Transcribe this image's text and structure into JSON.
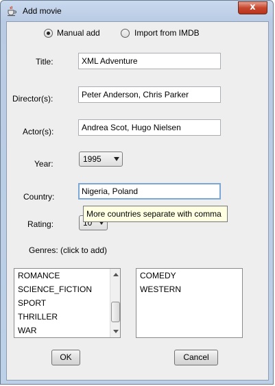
{
  "window": {
    "title": "Add movie",
    "close_symbol": "x",
    "close_icon": "close-icon",
    "app_icon": "java-cup-icon"
  },
  "mode": {
    "manual_label": "Manual add",
    "imdb_label": "Import from IMDB",
    "selected": "manual"
  },
  "form": {
    "title_label": "Title:",
    "title_value": "XML Adventure",
    "director_label": "Director(s):",
    "director_value": "Peter Anderson, Chris Parker",
    "actors_label": "Actor(s):",
    "actors_value": "Andrea Scot, Hugo Nielsen",
    "year_label": "Year:",
    "year_value": "1995",
    "country_label": "Country:",
    "country_value": "Nigeria, Poland",
    "country_tooltip": "More countries separate with comma",
    "rating_label": "Rating:",
    "rating_value": "10",
    "genres_label": "Genres: (click to add)"
  },
  "genres": {
    "available": [
      "ROMANCE",
      "SCIENCE_FICTION",
      "SPORT",
      "THRILLER",
      "WAR"
    ],
    "selected": [
      "COMEDY",
      "WESTERN"
    ],
    "available_scroll_position": 0.85
  },
  "buttons": {
    "ok_label": "OK",
    "cancel_label": "Cancel"
  }
}
